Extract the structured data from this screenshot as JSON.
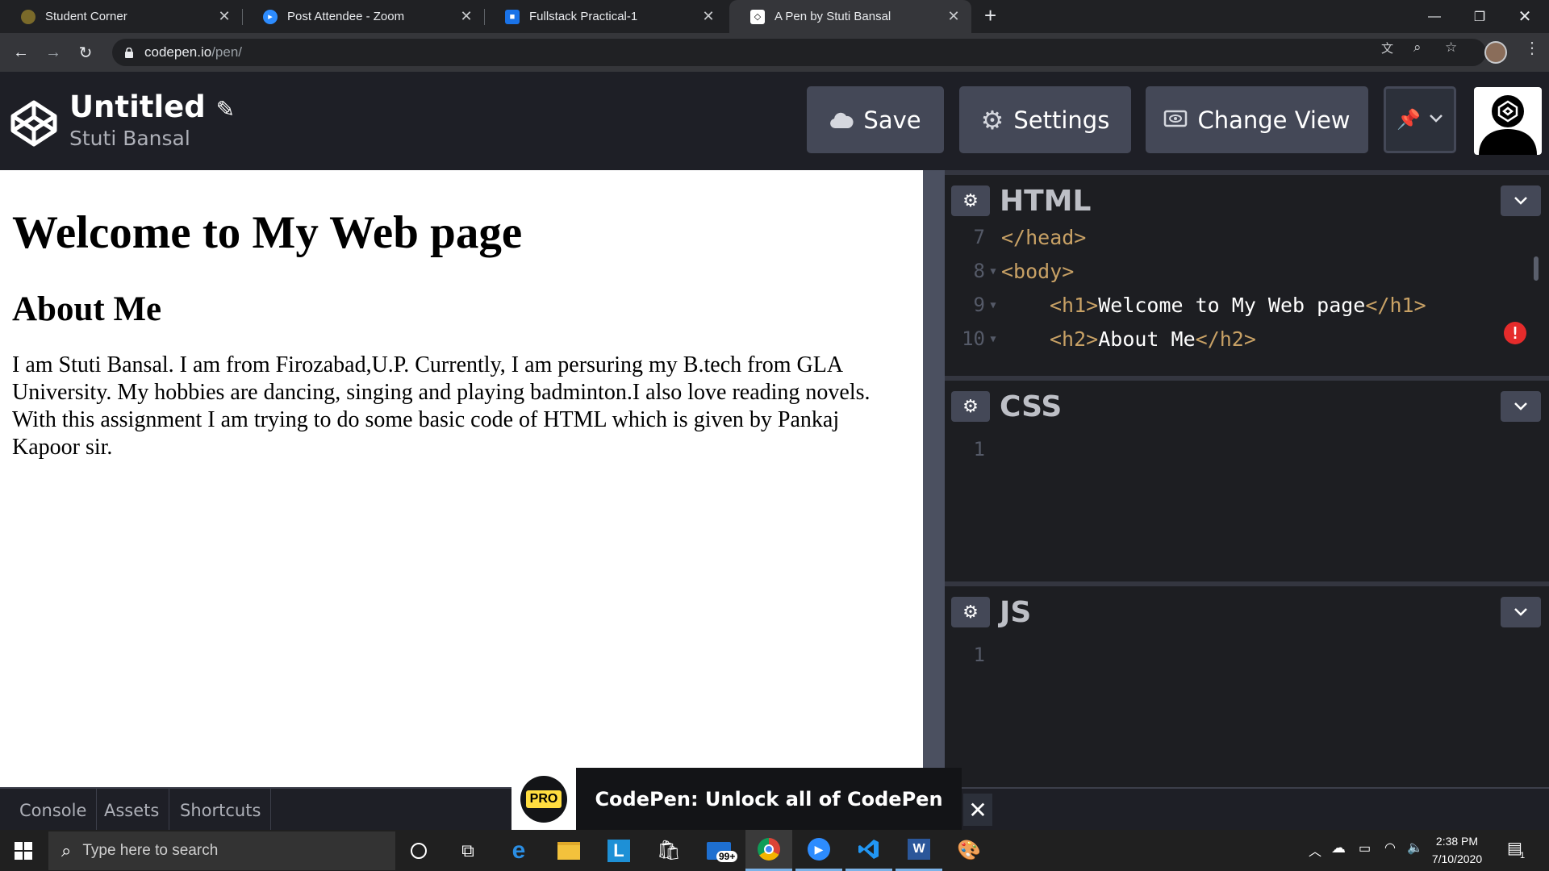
{
  "browser": {
    "tabs": [
      {
        "label": "Student Corner",
        "icon": "student-corner-favicon"
      },
      {
        "label": "Post Attendee - Zoom",
        "icon": "zoom-favicon"
      },
      {
        "label": "Fullstack Practical-1",
        "icon": "classroom-favicon"
      },
      {
        "label": "A Pen by Stuti Bansal",
        "icon": "codepen-favicon"
      }
    ],
    "url_host": "codepen.io",
    "url_path": "/pen/"
  },
  "header": {
    "title": "Untitled",
    "author": "Stuti Bansal",
    "save_label": "Save",
    "settings_label": "Settings",
    "change_view_label": "Change View"
  },
  "result": {
    "h1": "Welcome to My Web page",
    "h2": "About Me",
    "paragraph": "I am Stuti Bansal. I am from Firozabad,U.P. Currently, I am persuring my B.tech from GLA University. My hobbies are dancing, singing and playing badminton.I also love reading novels. With this assignment I am trying to do some basic code of HTML which is given by Pankaj Kapoor sir."
  },
  "editors": {
    "html": {
      "title": "HTML",
      "lines": [
        {
          "num": "7",
          "open": "</head>",
          "text": "",
          "close": ""
        },
        {
          "num": "8",
          "open": "<body>",
          "text": "",
          "close": ""
        },
        {
          "num": "9",
          "open": "<h1>",
          "text": "Welcome to My Web page",
          "close": "</h1>"
        },
        {
          "num": "10",
          "open": "<h2>",
          "text": "About Me",
          "close": "</h2>"
        }
      ]
    },
    "css": {
      "title": "CSS",
      "line_num": "1"
    },
    "js": {
      "title": "JS",
      "line_num": "1"
    }
  },
  "bottom": {
    "console": "Console",
    "assets": "Assets",
    "shortcuts": "Shortcuts",
    "promo_badge": "PRO",
    "promo_text": "CodePen: Unlock all of CodePen"
  },
  "taskbar": {
    "search_placeholder": "Type here to search",
    "mail_badge": "99+",
    "time": "2:38 PM",
    "date": "7/10/2020",
    "notification_count": "1"
  },
  "colors": {
    "codepen_dark": "#1e1f26",
    "button_gray": "#444857",
    "tag_color": "#c8a165",
    "error_red": "#e52b2b"
  }
}
